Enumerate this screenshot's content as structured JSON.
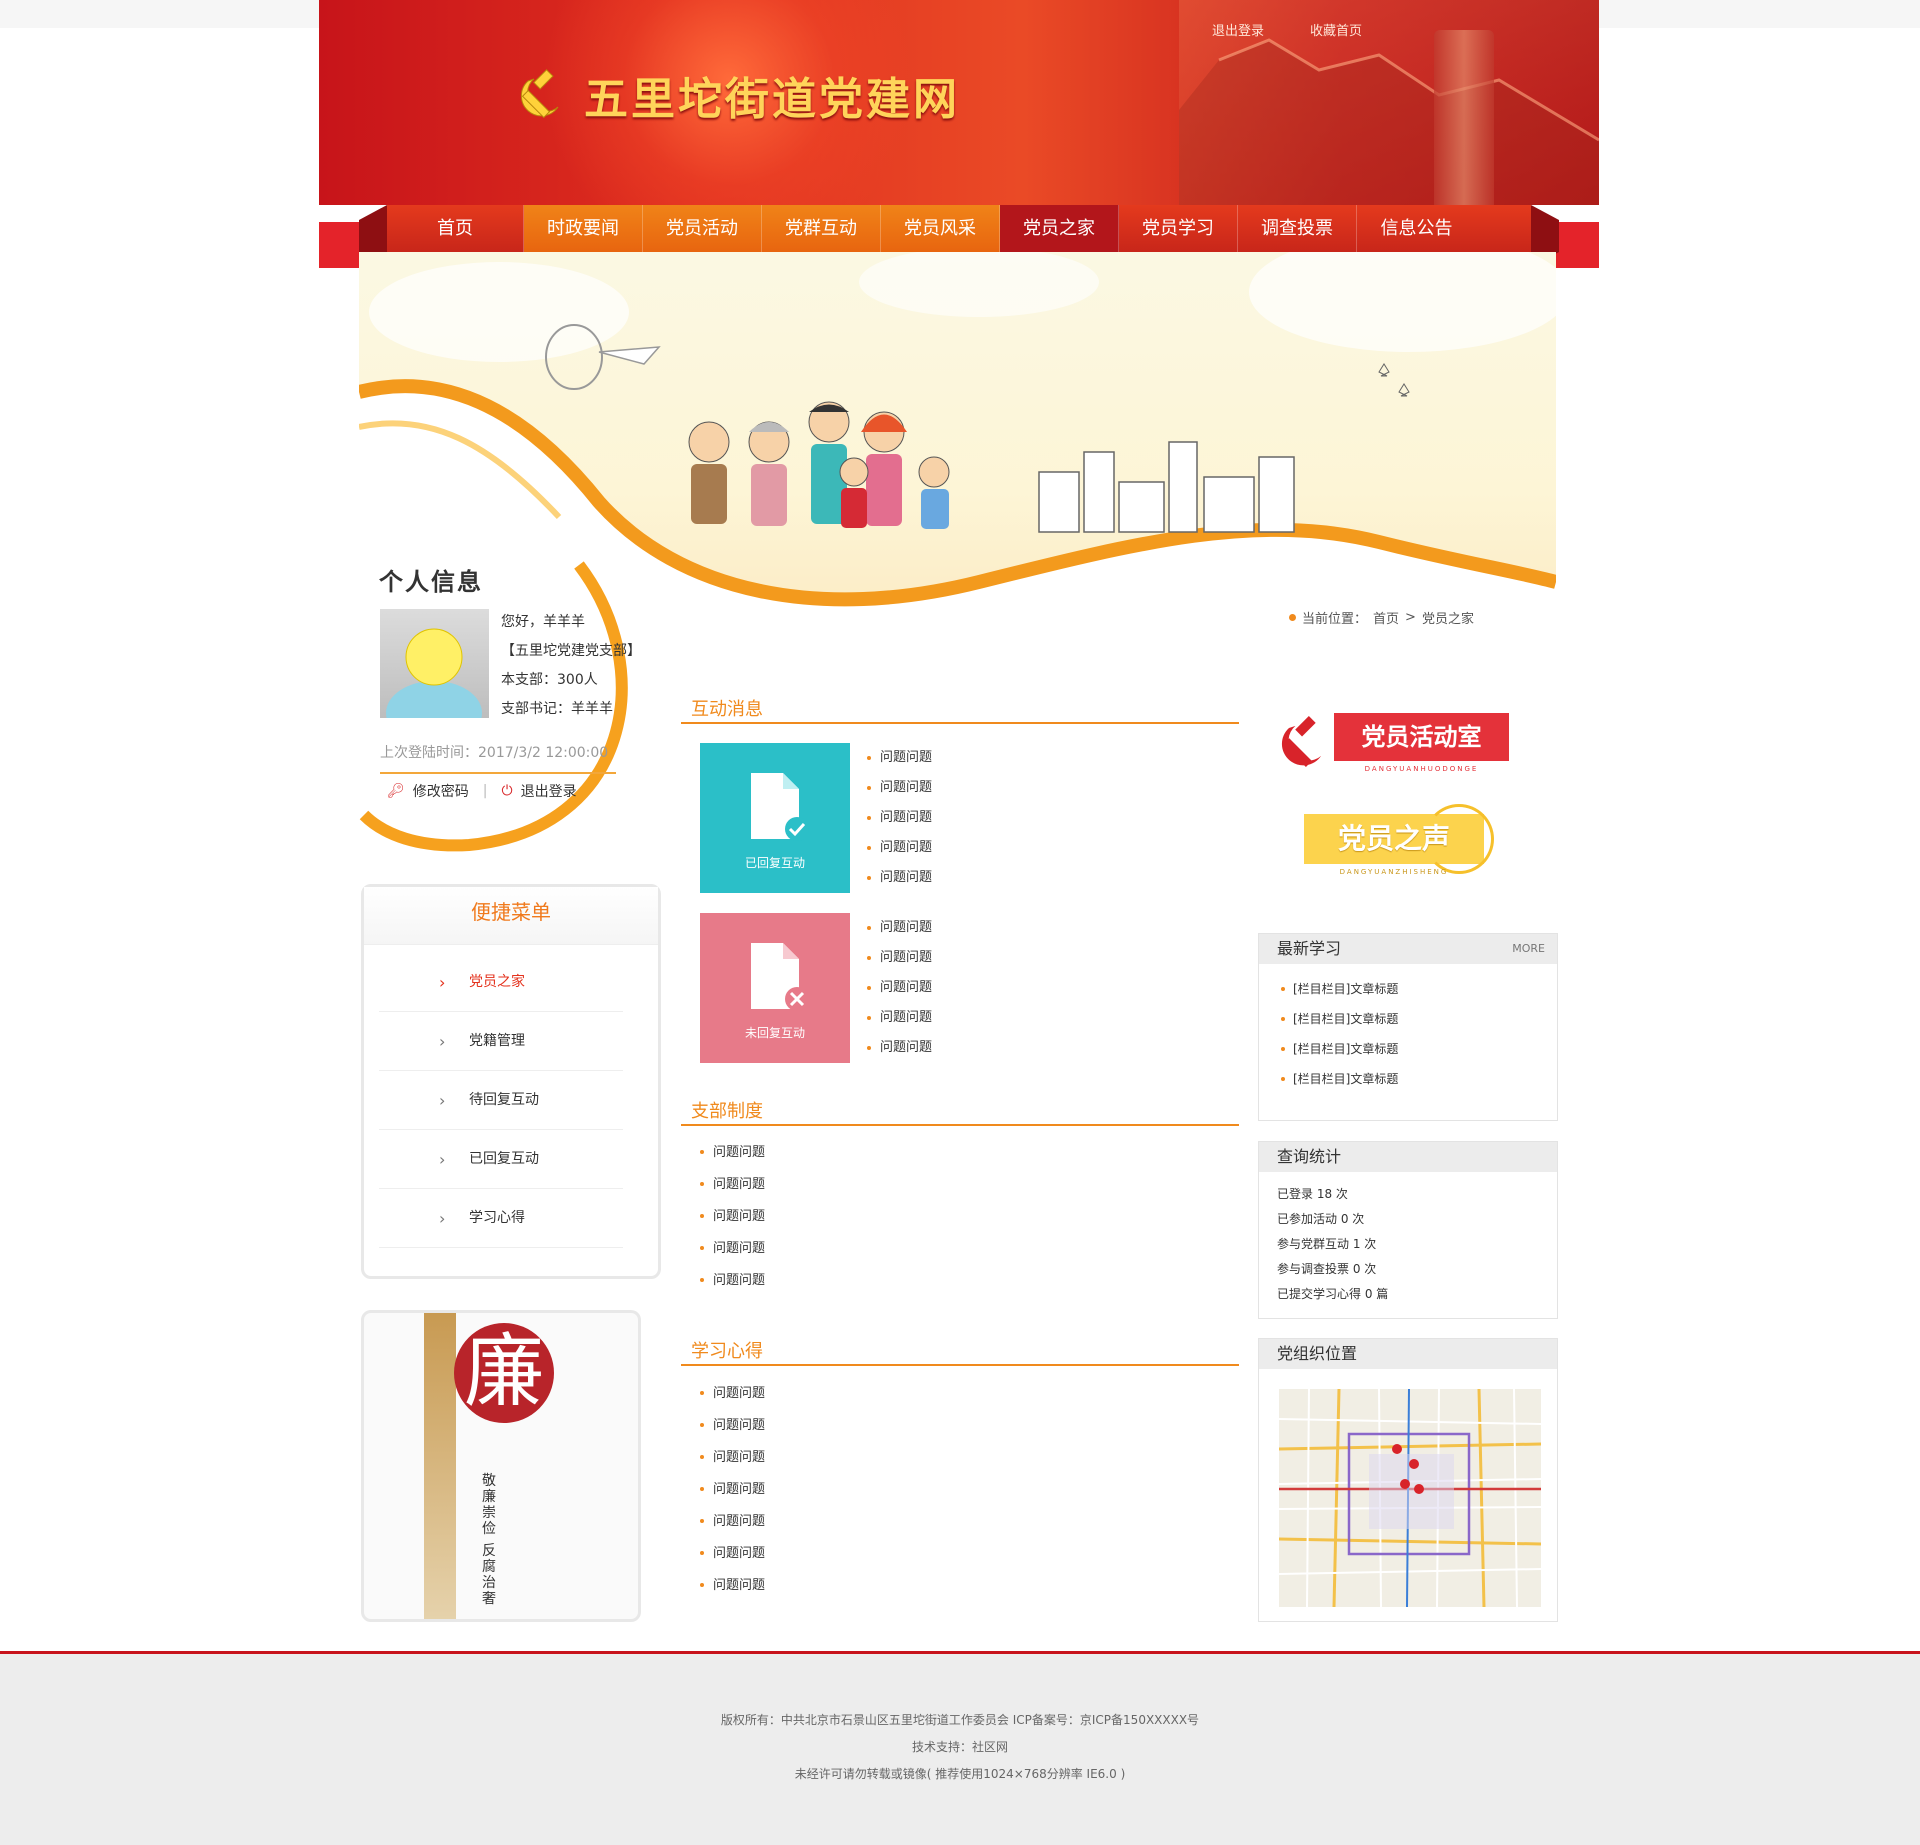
{
  "header": {
    "site_title": "五里坨街道党建网",
    "logout_link": "退出登录",
    "bookmark_link": "收藏首页"
  },
  "nav": {
    "items": [
      {
        "label": "首页"
      },
      {
        "label": "时政要闻"
      },
      {
        "label": "党员活动"
      },
      {
        "label": "党群互动"
      },
      {
        "label": "党员风采"
      },
      {
        "label": "党员之家"
      },
      {
        "label": "党员学习"
      },
      {
        "label": "调查投票"
      },
      {
        "label": "信息公告"
      }
    ],
    "active": "党员之家"
  },
  "breadcrumb": {
    "prefix": "当前位置：",
    "home": "首页",
    "separator": ">",
    "current": "党员之家"
  },
  "profile": {
    "title": "个人信息",
    "greeting": "您好，羊羊羊",
    "branch": "【五里坨党建党支部】",
    "members": "本支部：300人",
    "secretary": "支部书记：羊羊羊",
    "last_login": "上次登陆时间：2017/3/2 12:00:00",
    "change_password": "修改密码",
    "separator": "|",
    "logout": "退出登录"
  },
  "quick_menu": {
    "title": "便捷菜单",
    "items": [
      {
        "label": "党员之家"
      },
      {
        "label": "党籍管理"
      },
      {
        "label": "待回复互动"
      },
      {
        "label": "已回复互动"
      },
      {
        "label": "学习心得"
      }
    ]
  },
  "lian_banner": {
    "char": "廉",
    "line1": "敬廉崇俭",
    "line2": "反腐治奢"
  },
  "interactive": {
    "title": "互动消息",
    "replied_label": "已回复互动",
    "unreplied_label": "未回复互动",
    "replied_items": [
      "问题问题",
      "问题问题",
      "问题问题",
      "问题问题",
      "问题问题"
    ],
    "unreplied_items": [
      "问题问题",
      "问题问题",
      "问题问题",
      "问题问题",
      "问题问题"
    ]
  },
  "branch_rules": {
    "title": "支部制度",
    "items": [
      "问题问题",
      "问题问题",
      "问题问题",
      "问题问题",
      "问题问题"
    ]
  },
  "study_notes": {
    "title": "学习心得",
    "items": [
      "问题问题",
      "问题问题",
      "问题问题",
      "问题问题",
      "问题问题",
      "问题问题",
      "问题问题"
    ]
  },
  "right": {
    "activity_room": {
      "title": "党员活动室",
      "pinyin": "DANGYUANHUODONGE"
    },
    "voice": {
      "title": "党员之声",
      "pinyin": "DANGYUANZHISHENG"
    },
    "latest_study": {
      "title": "最新学习",
      "more": "MORE",
      "items": [
        "[栏目栏目]文章标题",
        "[栏目栏目]文章标题",
        "[栏目栏目]文章标题",
        "[栏目栏目]文章标题"
      ]
    },
    "stats": {
      "title": "查询统计",
      "items": [
        "已登录 18 次",
        "已参加活动 0 次",
        "参与党群互动 1 次",
        "参与调查投票 0 次",
        "已提交学习心得 0 篇"
      ]
    },
    "location": {
      "title": "党组织位置"
    }
  },
  "footer": {
    "line1": "版权所有：中共北京市石景山区五里坨街道工作委员会 ICP备案号：京ICP备150XXXXX号",
    "line2": "技术支持：社区网",
    "line3": "未经许可请勿转载或镜像( 推荐使用1024×768分辨率   IE6.0 )"
  },
  "colors": {
    "brand_red": "#c8141c",
    "accent_orange": "#f08a1d",
    "replied_tile": "#2bbfc8",
    "unreplied_tile": "#e77a89"
  }
}
